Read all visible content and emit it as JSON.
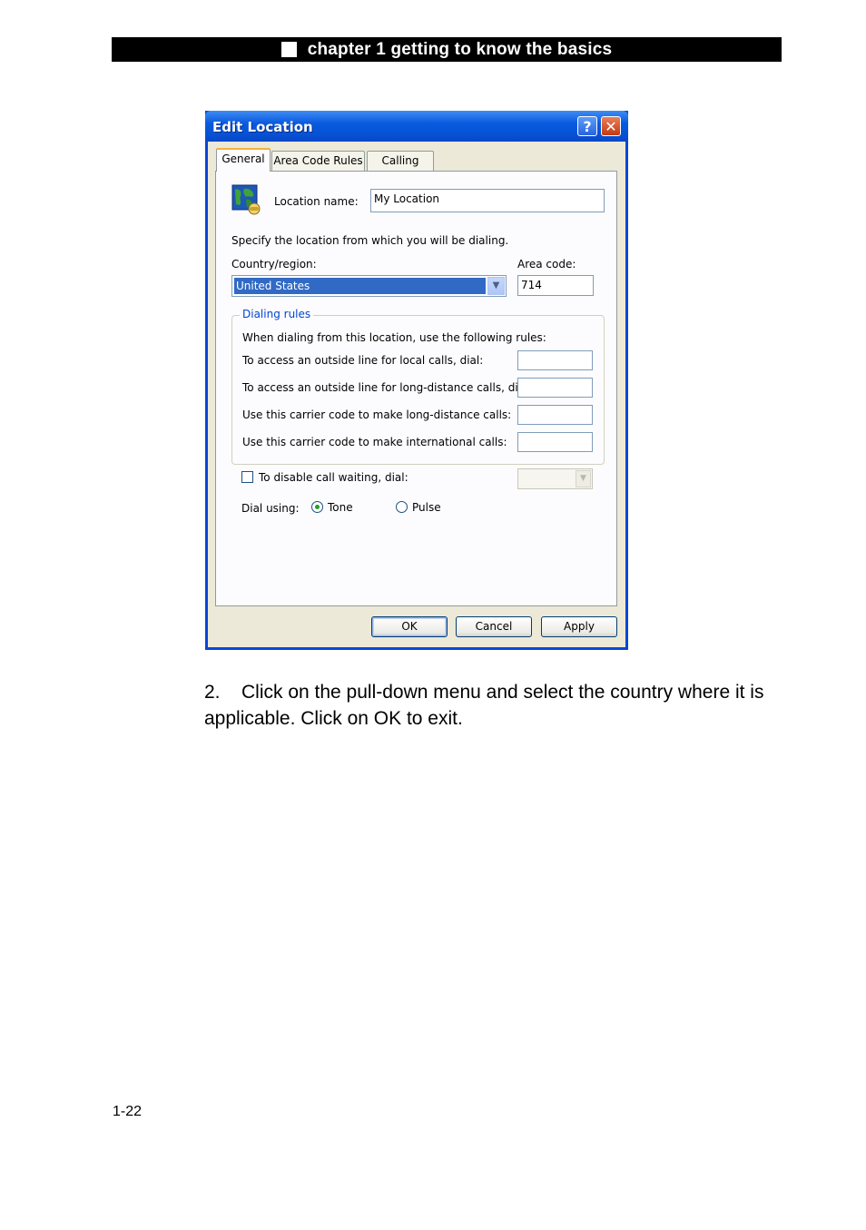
{
  "header": {
    "chapter_title": "chapter 1 getting to know the basics"
  },
  "dialog": {
    "title": "Edit Location",
    "help_glyph": "?",
    "close_glyph": "✕",
    "tabs": [
      "General",
      "Area Code Rules",
      "Calling Card"
    ],
    "location_name_label": "Location name:",
    "location_name_value": "My Location",
    "specify_text": "Specify the location from which you will be dialing.",
    "country_label": "Country/region:",
    "country_value": "United States",
    "area_code_label": "Area code:",
    "area_code_value": "714",
    "dialing_rules": {
      "title": "Dialing rules",
      "intro": "When dialing from this location, use the following rules:",
      "rows": [
        "To access an outside line for local calls, dial:",
        "To access an outside line for long-distance calls, dial:",
        "Use this carrier code to make long-distance calls:",
        "Use this carrier code to make international calls:"
      ]
    },
    "call_waiting_label": "To disable call waiting, dial:",
    "dial_using_label": "Dial using:",
    "tone_label": "Tone",
    "pulse_label": "Pulse",
    "buttons": {
      "ok": "OK",
      "cancel": "Cancel",
      "apply": "Apply"
    }
  },
  "instruction": {
    "number": "2.",
    "text": "Click on the pull-down menu and select the country where it is applicable. Click on OK to exit."
  },
  "page_number": "1-22"
}
